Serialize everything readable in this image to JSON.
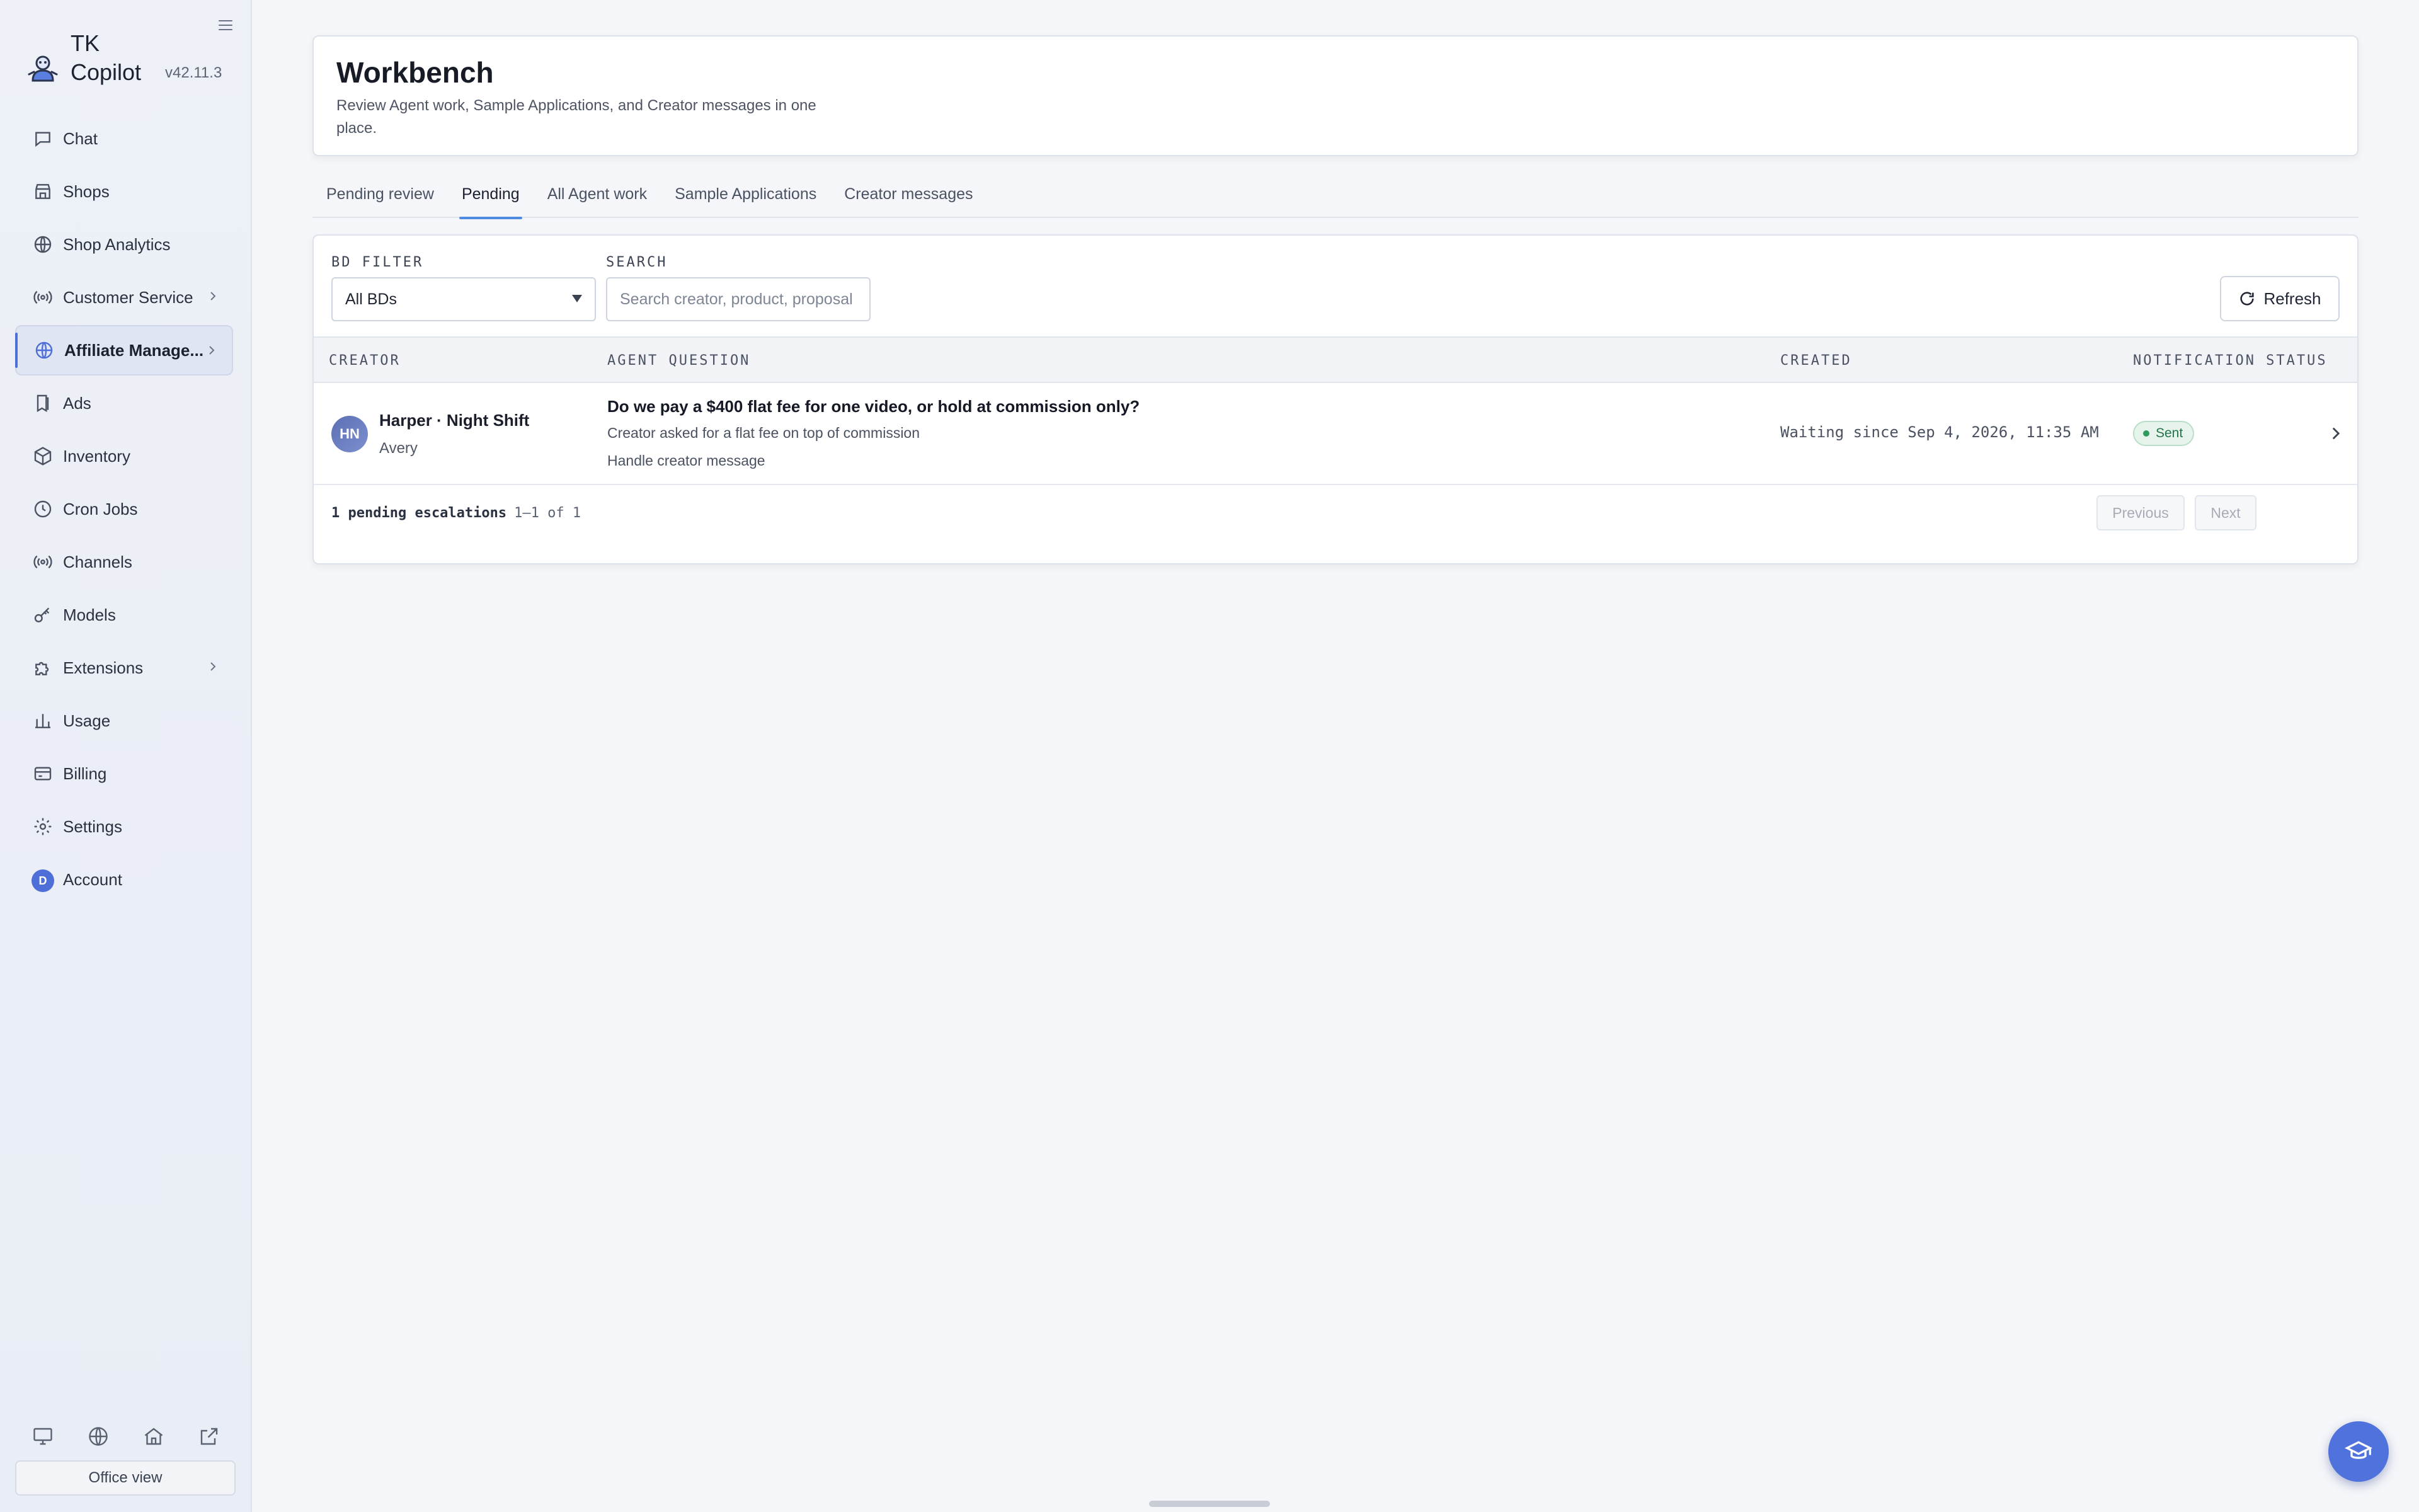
{
  "app": {
    "name": "TK Copilot",
    "version": "v42.11.3"
  },
  "sidebar": {
    "items": [
      {
        "label": "Chat",
        "icon": "chat-icon"
      },
      {
        "label": "Shops",
        "icon": "store-icon"
      },
      {
        "label": "Shop Analytics",
        "icon": "globe-icon"
      },
      {
        "label": "Customer Service",
        "icon": "broadcast-icon",
        "has_submenu": true
      },
      {
        "label": "Affiliate Manage...",
        "icon": "globe-icon",
        "has_submenu": true,
        "active": true
      },
      {
        "label": "Ads",
        "icon": "book-icon"
      },
      {
        "label": "Inventory",
        "icon": "box-icon"
      },
      {
        "label": "Cron Jobs",
        "icon": "clock-icon"
      },
      {
        "label": "Channels",
        "icon": "broadcast-icon"
      },
      {
        "label": "Models",
        "icon": "key-icon"
      },
      {
        "label": "Extensions",
        "icon": "puzzle-icon",
        "has_submenu": true
      },
      {
        "label": "Usage",
        "icon": "bar-chart-icon"
      },
      {
        "label": "Billing",
        "icon": "credit-card-icon"
      },
      {
        "label": "Settings",
        "icon": "gear-icon"
      },
      {
        "label": "Account",
        "icon": "avatar",
        "avatar_initial": "D"
      }
    ],
    "footer_icons": [
      "monitor-icon",
      "globe-icon",
      "home-icon",
      "external-link-icon"
    ],
    "office_view_label": "Office view"
  },
  "header": {
    "title": "Workbench",
    "subtitle": "Review Agent work, Sample Applications, and Creator messages in one place."
  },
  "tabs": [
    {
      "label": "Pending review",
      "active": false
    },
    {
      "label": "Pending",
      "active": true
    },
    {
      "label": "All Agent work",
      "active": false
    },
    {
      "label": "Sample Applications",
      "active": false
    },
    {
      "label": "Creator messages",
      "active": false
    }
  ],
  "filters": {
    "bd_filter_label": "BD FILTER",
    "bd_filter_value": "All BDs",
    "search_label": "SEARCH",
    "search_placeholder": "Search creator, product, proposal",
    "refresh_label": "Refresh"
  },
  "table": {
    "columns": [
      "CREATOR",
      "AGENT QUESTION",
      "CREATED",
      "NOTIFICATION STATUS"
    ],
    "rows": [
      {
        "avatar_initials": "HN",
        "creator_name": "Harper · Night Shift",
        "creator_sub": "Avery",
        "question": "Do we pay a $400 flat fee for one video, or hold at commission only?",
        "detail": "Creator asked for a flat fee on top of commission",
        "action": "Handle creator message",
        "created": "Waiting since Sep 4, 2026, 11:35 AM",
        "status": "Sent"
      }
    ]
  },
  "pagination": {
    "summary": "1 pending escalations",
    "range": "1–1 of 1",
    "previous_label": "Previous",
    "next_label": "Next"
  },
  "colors": {
    "accent": "#4f72dd",
    "active_tab_underline": "#4f8be0",
    "status_sent": "#2f9a5e"
  }
}
